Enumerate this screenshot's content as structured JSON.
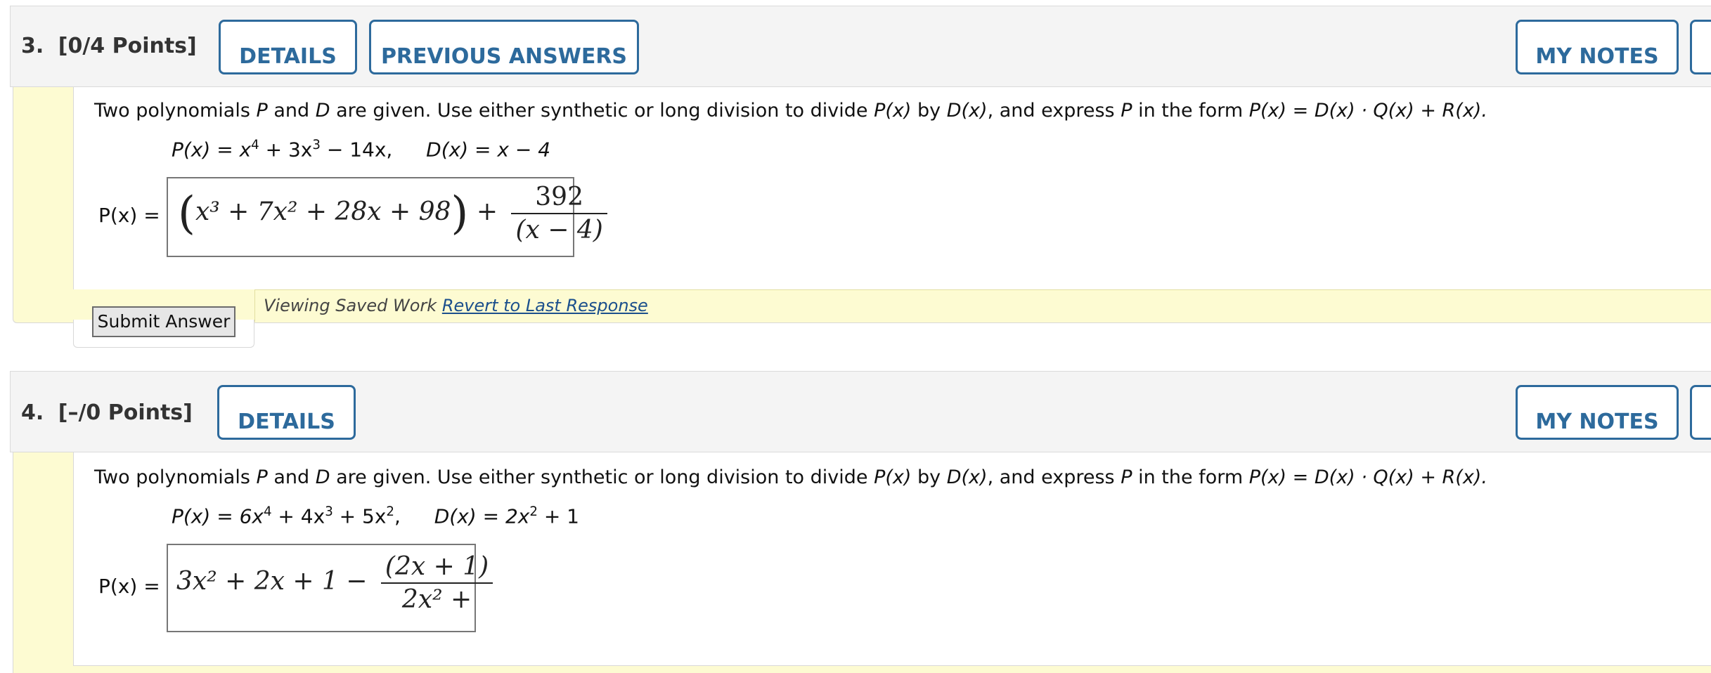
{
  "q3": {
    "number": "3.",
    "points": "[0/4 Points]",
    "details_label": "DETAILS",
    "prev_answers_label": "PREVIOUS ANSWERS",
    "my_notes_label": "MY NOTES",
    "prompt_a": "Two polynomials ",
    "prompt_p": "P",
    "prompt_and": " and ",
    "prompt_d": "D",
    "prompt_b": " are given. Use either synthetic or long division to divide  ",
    "prompt_px": "P(x)",
    "prompt_by": "  by  ",
    "prompt_dx": "D(x)",
    "prompt_c": ",  and express ",
    "prompt_p2": "P",
    "prompt_d2": " in the form  ",
    "prompt_form": "P(x) = D(x) · Q(x) + R(x).",
    "given_p": "P(x) = x",
    "given_p_exp1": "4",
    "given_p_mid": " + 3x",
    "given_p_exp2": "3",
    "given_p_end": " − 14x,",
    "given_d": "D(x) = x − 4",
    "answer_label": "P(x) =",
    "answer_quot": "x³ + 7x² + 28x + 98",
    "answer_num": "392",
    "answer_den": "(x − 4)",
    "submit_label": "Submit Answer",
    "saved_text": "Viewing Saved Work ",
    "revert_link": "Revert to Last Response"
  },
  "q4": {
    "number": "4.",
    "points": "[–/0 Points]",
    "details_label": "DETAILS",
    "my_notes_label": "MY NOTES",
    "prompt_a": "Two polynomials ",
    "prompt_p": "P",
    "prompt_and": " and ",
    "prompt_d": "D",
    "prompt_b": " are given. Use either synthetic or long division to divide  ",
    "prompt_px": "P(x)",
    "prompt_by": "  by  ",
    "prompt_dx": "D(x)",
    "prompt_c": ",  and express ",
    "prompt_p2": "P",
    "prompt_d2": " in the form  ",
    "prompt_form": "P(x) = D(x) · Q(x) + R(x).",
    "given_p": "P(x) = 6x",
    "given_p_exp1": "4",
    "given_p_mid": " + 4x",
    "given_p_exp2": "3",
    "given_p_mid2": " + 5x",
    "given_p_exp3": "2",
    "given_p_end": ",",
    "given_d": "D(x) = 2x",
    "given_d_exp": "2",
    "given_d_end": " + 1",
    "answer_label": "P(x) =",
    "answer_quot": "3x² + 2x + 1 −",
    "answer_num": "(2x + 1)",
    "answer_den": "2x² +"
  },
  "colors": {
    "accent": "#2d6a9c",
    "answer_bg": "#fdfbd2",
    "header_bg": "#f4f4f4",
    "link": "#1b4f8c"
  }
}
